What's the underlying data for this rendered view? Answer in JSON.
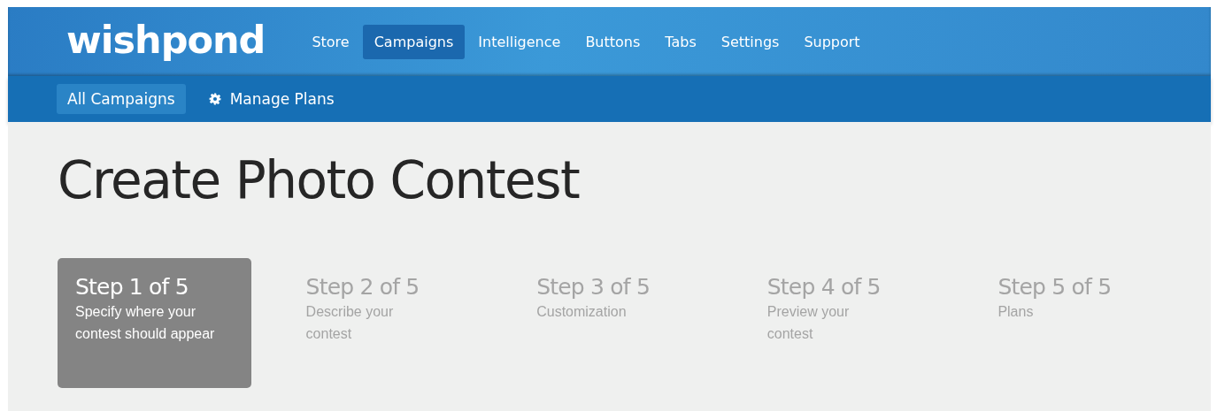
{
  "brand": "wishpond",
  "nav": [
    {
      "label": "Store",
      "selected": false
    },
    {
      "label": "Campaigns",
      "selected": true
    },
    {
      "label": "Intelligence",
      "selected": false
    },
    {
      "label": "Buttons",
      "selected": false
    },
    {
      "label": "Tabs",
      "selected": false
    },
    {
      "label": "Settings",
      "selected": false
    },
    {
      "label": "Support",
      "selected": false
    }
  ],
  "subnav": [
    {
      "label": "All Campaigns",
      "selected": true,
      "kind": "plain"
    },
    {
      "label": "Manage Plans",
      "selected": false,
      "kind": "gear"
    }
  ],
  "title": "Create Photo Contest",
  "steps": [
    {
      "label": "Step 1 of 5",
      "description": "Specify where your contest should appear",
      "selected": true
    },
    {
      "label": "Step 2 of 5",
      "description": "Describe your contest",
      "selected": false
    },
    {
      "label": "Step 3 of 5",
      "description": "Customization",
      "selected": false
    },
    {
      "label": "Step 4 of 5",
      "description": "Preview your contest",
      "selected": false
    },
    {
      "label": "Step 5 of 5",
      "description": "Plans",
      "selected": false
    }
  ]
}
